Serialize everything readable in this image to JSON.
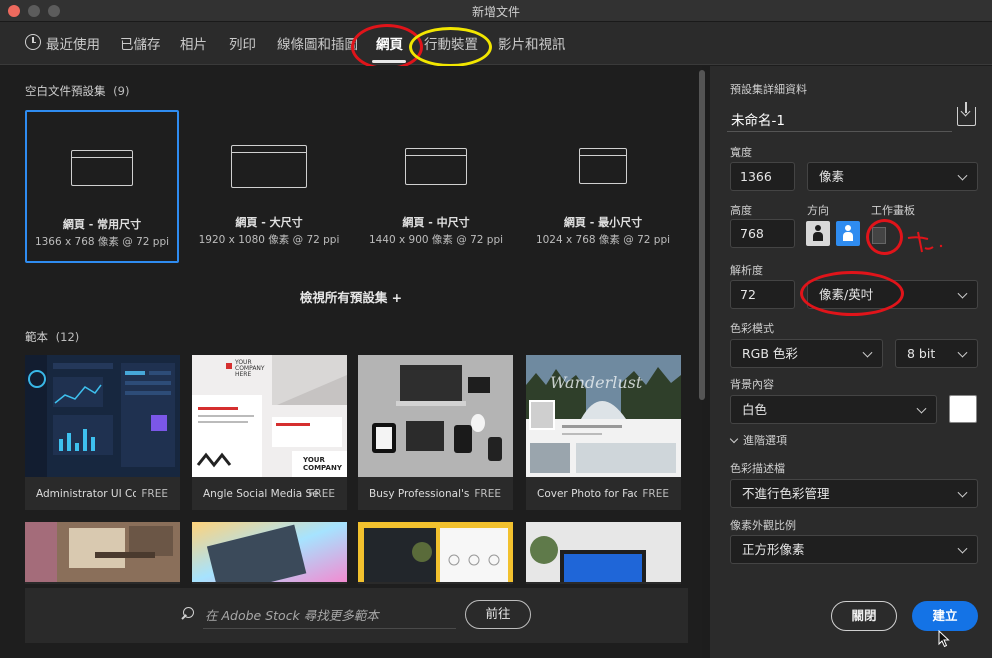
{
  "window": {
    "title": "新增文件"
  },
  "tabs": [
    {
      "label": "最近使用"
    },
    {
      "label": "已儲存"
    },
    {
      "label": "相片"
    },
    {
      "label": "列印"
    },
    {
      "label": "線條圖和插圖"
    },
    {
      "label": "網頁",
      "active": true
    },
    {
      "label": "行動裝置"
    },
    {
      "label": "影片和視訊"
    }
  ],
  "presets": {
    "heading": "空白文件預設集",
    "count": "(9)",
    "items": [
      {
        "name": "網頁 - 常用尺寸",
        "size": "1366 x 768 像素 @ 72 ppi",
        "selected": true
      },
      {
        "name": "網頁 - 大尺寸",
        "size": "1920 x 1080 像素 @ 72 ppi"
      },
      {
        "name": "網頁 - 中尺寸",
        "size": "1440 x 900 像素 @ 72 ppi"
      },
      {
        "name": "網頁 - 最小尺寸",
        "size": "1024 x 768 像素 @ 72 ppi"
      }
    ],
    "view_all": "檢視所有預設集 +"
  },
  "templates": {
    "heading": "範本",
    "count": "(12)",
    "items": [
      {
        "name": "Administrator UI Co...",
        "badge": "FREE"
      },
      {
        "name": "Angle Social Media Set",
        "badge": "FREE"
      },
      {
        "name": "Busy Professional's...",
        "badge": "FREE"
      },
      {
        "name": "Cover Photo for Face...",
        "badge": "FREE"
      }
    ],
    "thumb_texts": {
      "t2_header": "YOUR COMPANY HERE",
      "t2_footer": "YOUR COMPANY",
      "t4_title": "Wanderlust"
    }
  },
  "stock": {
    "placeholder": "在 Adobe Stock 尋找更多範本",
    "go_label": "前往"
  },
  "details": {
    "heading": "預設集詳細資料",
    "name_value": "未命名-1",
    "width_label": "寬度",
    "width_value": "1366",
    "width_unit": "像素",
    "height_label": "高度",
    "height_value": "768",
    "orientation_label": "方向",
    "artboard_label": "工作畫板",
    "resolution_label": "解析度",
    "resolution_value": "72",
    "resolution_unit": "像素/英吋",
    "color_mode_label": "色彩模式",
    "color_mode_value": "RGB 色彩",
    "bit_depth": "8 bit",
    "background_label": "背景內容",
    "background_value": "白色",
    "background_color": "#ffffff",
    "advanced_label": "進階選項",
    "profile_label": "色彩描述檔",
    "profile_value": "不進行色彩管理",
    "pixel_aspect_label": "像素外觀比例",
    "pixel_aspect_value": "正方形像素"
  },
  "actions": {
    "close_label": "關閉",
    "create_label": "建立"
  },
  "colors": {
    "accent": "#1473e6",
    "selection": "#2f8cf0",
    "annotation_red": "#e0141a",
    "annotation_yellow": "#f2e600"
  }
}
